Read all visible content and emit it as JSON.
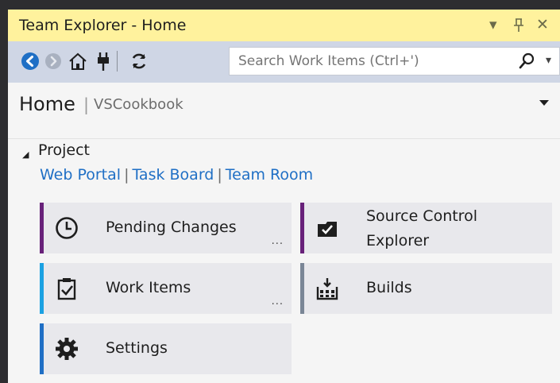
{
  "window": {
    "title": "Team Explorer - Home",
    "controls": {
      "dropdown": "▾",
      "pin": "ᵖ",
      "close": "✕"
    }
  },
  "toolbar": {
    "buttons": [
      "back-icon",
      "forward-icon",
      "home-icon",
      "connect-icon",
      "refresh-icon"
    ],
    "search_placeholder": "Search Work Items (Ctrl+')"
  },
  "header": {
    "page": "Home",
    "separator": "|",
    "team": "VSCookbook"
  },
  "project": {
    "title": "Project",
    "links": [
      "Web Portal",
      "Task Board",
      "Team Room"
    ],
    "link_separator": "|"
  },
  "tiles": {
    "pending": {
      "label": "Pending Changes",
      "more": "...",
      "accent": "#68217a",
      "icon": "clock-icon"
    },
    "source": {
      "label_line1": "Source Control",
      "label_line2": "Explorer",
      "accent": "#68217a",
      "icon": "source-control-icon"
    },
    "work": {
      "label": "Work Items",
      "more": "...",
      "accent": "#1ba1e2",
      "icon": "clipboard-check-icon"
    },
    "builds": {
      "label": "Builds",
      "accent": "#7a8696",
      "icon": "builds-icon"
    },
    "settings": {
      "label": "Settings",
      "accent": "#1f6fc5",
      "icon": "gear-icon"
    }
  },
  "colors": {
    "title_bar": "#fff29d",
    "toolbar": "#cfd6e5",
    "link": "#1f6fc5",
    "back_button": "#1f6fc5"
  }
}
